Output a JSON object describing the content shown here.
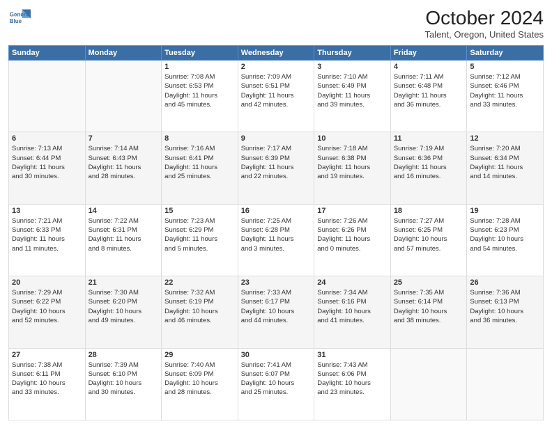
{
  "header": {
    "logo_line1": "General",
    "logo_line2": "Blue",
    "title": "October 2024",
    "subtitle": "Talent, Oregon, United States"
  },
  "weekdays": [
    "Sunday",
    "Monday",
    "Tuesday",
    "Wednesday",
    "Thursday",
    "Friday",
    "Saturday"
  ],
  "weeks": [
    [
      {
        "day": "",
        "info": ""
      },
      {
        "day": "",
        "info": ""
      },
      {
        "day": "1",
        "info": "Sunrise: 7:08 AM\nSunset: 6:53 PM\nDaylight: 11 hours\nand 45 minutes."
      },
      {
        "day": "2",
        "info": "Sunrise: 7:09 AM\nSunset: 6:51 PM\nDaylight: 11 hours\nand 42 minutes."
      },
      {
        "day": "3",
        "info": "Sunrise: 7:10 AM\nSunset: 6:49 PM\nDaylight: 11 hours\nand 39 minutes."
      },
      {
        "day": "4",
        "info": "Sunrise: 7:11 AM\nSunset: 6:48 PM\nDaylight: 11 hours\nand 36 minutes."
      },
      {
        "day": "5",
        "info": "Sunrise: 7:12 AM\nSunset: 6:46 PM\nDaylight: 11 hours\nand 33 minutes."
      }
    ],
    [
      {
        "day": "6",
        "info": "Sunrise: 7:13 AM\nSunset: 6:44 PM\nDaylight: 11 hours\nand 30 minutes."
      },
      {
        "day": "7",
        "info": "Sunrise: 7:14 AM\nSunset: 6:43 PM\nDaylight: 11 hours\nand 28 minutes."
      },
      {
        "day": "8",
        "info": "Sunrise: 7:16 AM\nSunset: 6:41 PM\nDaylight: 11 hours\nand 25 minutes."
      },
      {
        "day": "9",
        "info": "Sunrise: 7:17 AM\nSunset: 6:39 PM\nDaylight: 11 hours\nand 22 minutes."
      },
      {
        "day": "10",
        "info": "Sunrise: 7:18 AM\nSunset: 6:38 PM\nDaylight: 11 hours\nand 19 minutes."
      },
      {
        "day": "11",
        "info": "Sunrise: 7:19 AM\nSunset: 6:36 PM\nDaylight: 11 hours\nand 16 minutes."
      },
      {
        "day": "12",
        "info": "Sunrise: 7:20 AM\nSunset: 6:34 PM\nDaylight: 11 hours\nand 14 minutes."
      }
    ],
    [
      {
        "day": "13",
        "info": "Sunrise: 7:21 AM\nSunset: 6:33 PM\nDaylight: 11 hours\nand 11 minutes."
      },
      {
        "day": "14",
        "info": "Sunrise: 7:22 AM\nSunset: 6:31 PM\nDaylight: 11 hours\nand 8 minutes."
      },
      {
        "day": "15",
        "info": "Sunrise: 7:23 AM\nSunset: 6:29 PM\nDaylight: 11 hours\nand 5 minutes."
      },
      {
        "day": "16",
        "info": "Sunrise: 7:25 AM\nSunset: 6:28 PM\nDaylight: 11 hours\nand 3 minutes."
      },
      {
        "day": "17",
        "info": "Sunrise: 7:26 AM\nSunset: 6:26 PM\nDaylight: 11 hours\nand 0 minutes."
      },
      {
        "day": "18",
        "info": "Sunrise: 7:27 AM\nSunset: 6:25 PM\nDaylight: 10 hours\nand 57 minutes."
      },
      {
        "day": "19",
        "info": "Sunrise: 7:28 AM\nSunset: 6:23 PM\nDaylight: 10 hours\nand 54 minutes."
      }
    ],
    [
      {
        "day": "20",
        "info": "Sunrise: 7:29 AM\nSunset: 6:22 PM\nDaylight: 10 hours\nand 52 minutes."
      },
      {
        "day": "21",
        "info": "Sunrise: 7:30 AM\nSunset: 6:20 PM\nDaylight: 10 hours\nand 49 minutes."
      },
      {
        "day": "22",
        "info": "Sunrise: 7:32 AM\nSunset: 6:19 PM\nDaylight: 10 hours\nand 46 minutes."
      },
      {
        "day": "23",
        "info": "Sunrise: 7:33 AM\nSunset: 6:17 PM\nDaylight: 10 hours\nand 44 minutes."
      },
      {
        "day": "24",
        "info": "Sunrise: 7:34 AM\nSunset: 6:16 PM\nDaylight: 10 hours\nand 41 minutes."
      },
      {
        "day": "25",
        "info": "Sunrise: 7:35 AM\nSunset: 6:14 PM\nDaylight: 10 hours\nand 38 minutes."
      },
      {
        "day": "26",
        "info": "Sunrise: 7:36 AM\nSunset: 6:13 PM\nDaylight: 10 hours\nand 36 minutes."
      }
    ],
    [
      {
        "day": "27",
        "info": "Sunrise: 7:38 AM\nSunset: 6:11 PM\nDaylight: 10 hours\nand 33 minutes."
      },
      {
        "day": "28",
        "info": "Sunrise: 7:39 AM\nSunset: 6:10 PM\nDaylight: 10 hours\nand 30 minutes."
      },
      {
        "day": "29",
        "info": "Sunrise: 7:40 AM\nSunset: 6:09 PM\nDaylight: 10 hours\nand 28 minutes."
      },
      {
        "day": "30",
        "info": "Sunrise: 7:41 AM\nSunset: 6:07 PM\nDaylight: 10 hours\nand 25 minutes."
      },
      {
        "day": "31",
        "info": "Sunrise: 7:43 AM\nSunset: 6:06 PM\nDaylight: 10 hours\nand 23 minutes."
      },
      {
        "day": "",
        "info": ""
      },
      {
        "day": "",
        "info": ""
      }
    ]
  ]
}
